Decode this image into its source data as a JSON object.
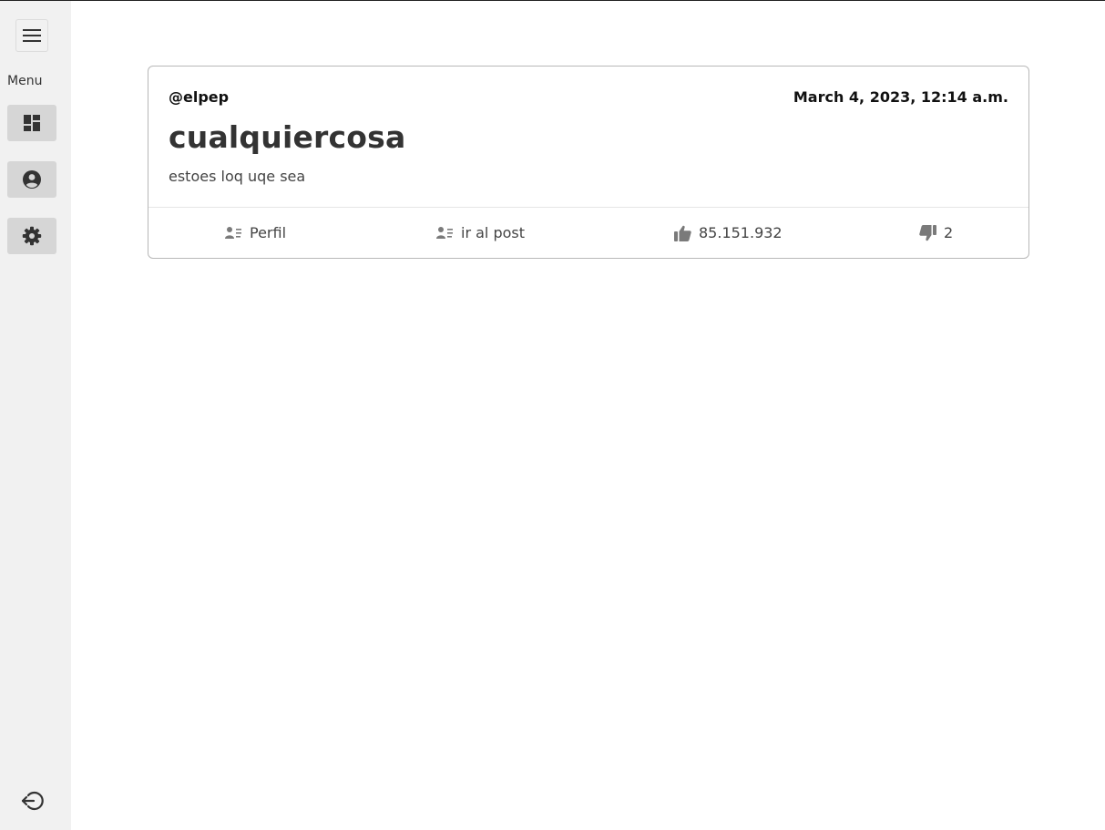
{
  "sidebar": {
    "menu_label": "Menu",
    "toggle_icon": "hamburger-icon",
    "items": [
      {
        "icon": "dashboard-icon"
      },
      {
        "icon": "account-circle-icon"
      },
      {
        "icon": "gear-icon"
      }
    ],
    "logout_icon": "logout-icon"
  },
  "post": {
    "author": "@elpep",
    "date": "March 4, 2023, 12:14 a.m.",
    "title": "cualquiercosa",
    "body": "estoes loq uqe sea",
    "actions": {
      "profile_label": "Perfil",
      "open_post_label": "ir al post",
      "likes": "85.151.932",
      "dislikes": "2"
    }
  },
  "colors": {
    "sidebar_bg": "#f1f1f1",
    "sidebar_button_bg": "#d6d6d6",
    "icon_gray": "#7a7a7a",
    "border": "#b8b8b8"
  }
}
